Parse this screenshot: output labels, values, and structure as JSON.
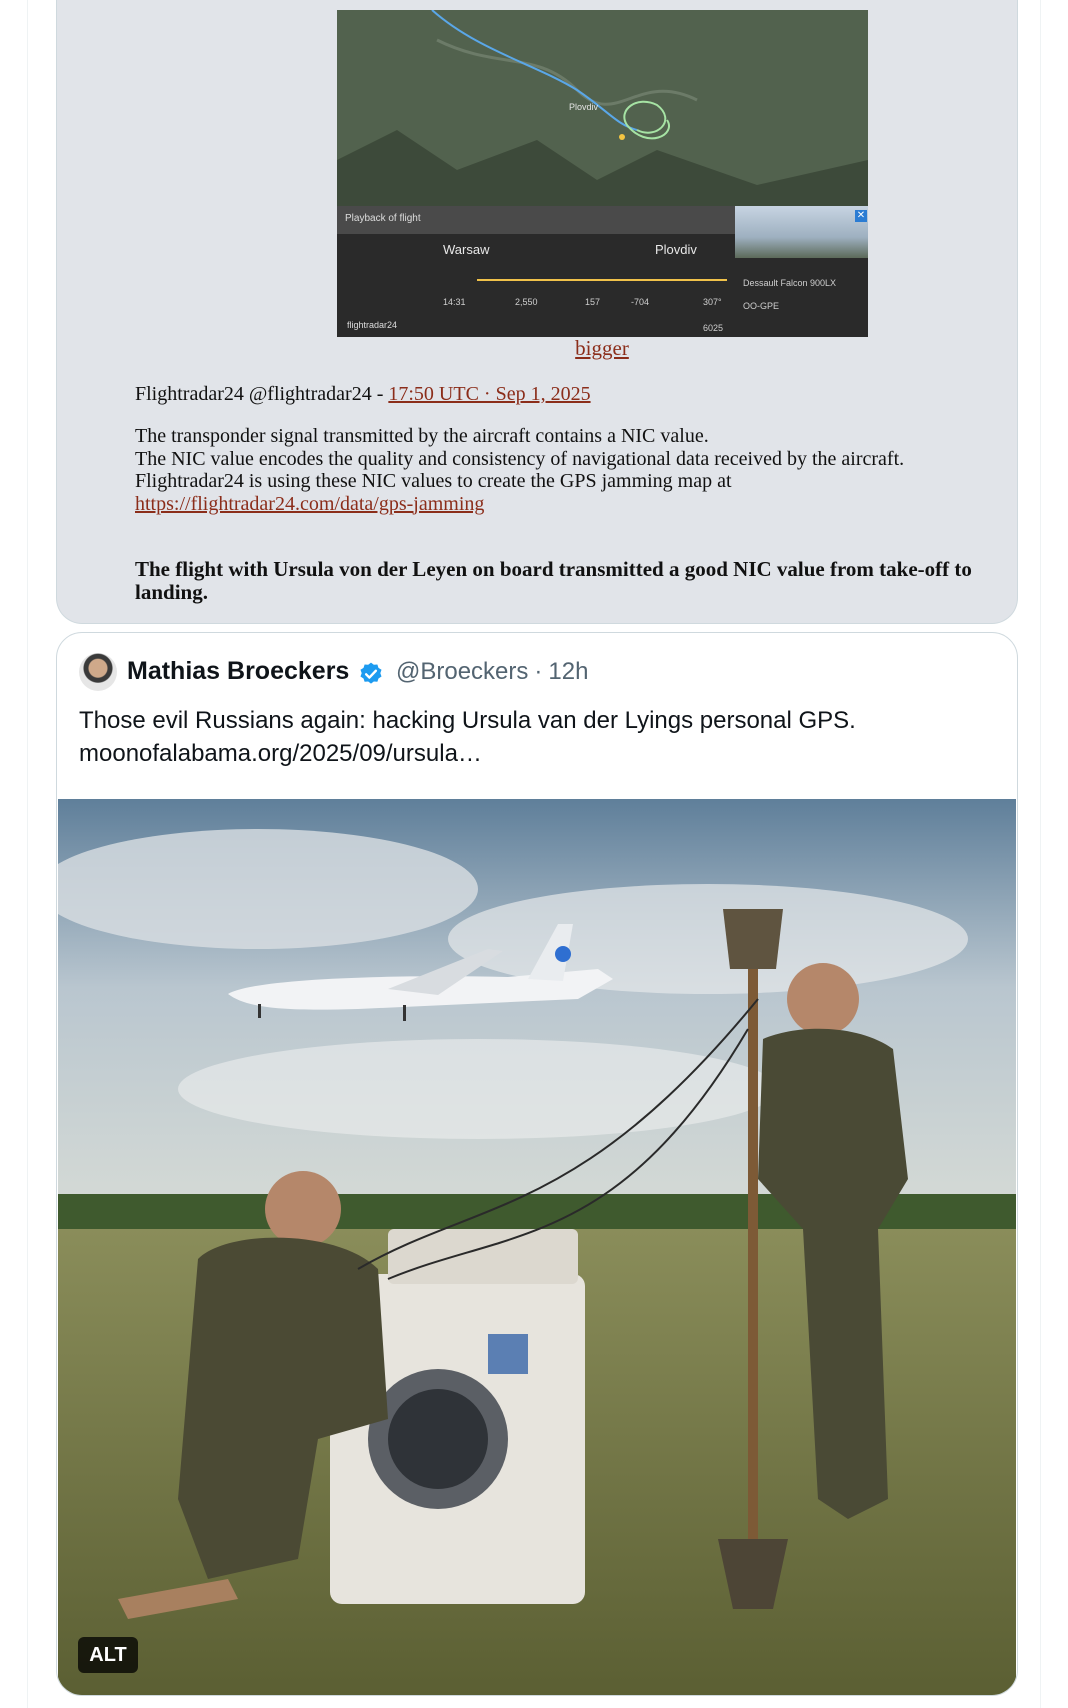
{
  "article": {
    "flightradar": {
      "panel_title": "Playback of flight",
      "from_city": "Warsaw",
      "to_city": "Plovdiv",
      "time": "14:31",
      "altitude": "2,550",
      "speed": "157",
      "vertical": "-704",
      "track": "307°",
      "squawk": "6025",
      "aircraft": "Dessault Falcon 900LX",
      "registration": "OO-GPE",
      "logo": "flightradar24",
      "map_city": "Plovdiv"
    },
    "bigger_link": "bigger",
    "source_prefix": "Flightradar24 @flightradar24 - ",
    "source_link": "17:50 UTC · Sep 1, 2025",
    "paragraph_1": "The transponder signal transmitted by the aircraft contains a NIC value.",
    "paragraph_2": "The NIC value encodes the quality and consistency of navigational data received by the aircraft.",
    "paragraph_3": "Flightradar24 is using these NIC values to create the GPS jamming map at",
    "jamming_url": "https://flightradar24.com/data/gps-jamming",
    "bold_paragraph": "The flight with Ursula von der Leyen on board transmitted a good NIC value from take-off to landing."
  },
  "tweet": {
    "author_name": "Mathias Broeckers",
    "handle": "@Broeckers",
    "time": "12h",
    "text_line_1": "Those evil Russians again: hacking Ursula van der Lyings personal GPS.",
    "text_line_2": "moonofalabama.org/2025/09/ursula…",
    "alt_badge": "ALT"
  },
  "colors": {
    "link": "#8b2d1a",
    "verified": "#1d9bf0",
    "card_bg": "#e1e4e9"
  }
}
